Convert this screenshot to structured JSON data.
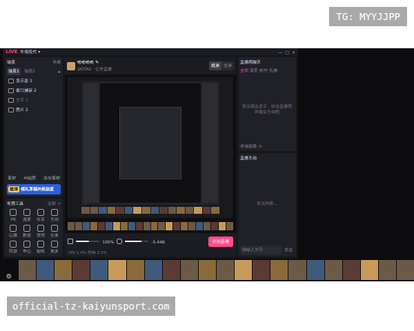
{
  "watermarks": {
    "top": "TG: MYYJJPP",
    "bottom": "official-tz-kaiyunsport.com"
  },
  "app": {
    "logo": "LIVE",
    "mode": "常规模式 ▾",
    "window_controls": [
      "—",
      "□",
      "×"
    ]
  },
  "scenes": {
    "title": "场景",
    "tool": "导播",
    "add": "+",
    "tabs": [
      {
        "label": "场景1",
        "selected": true
      },
      {
        "label": "场景2",
        "selected": false
      }
    ],
    "sources": [
      {
        "label": "显示器 1",
        "visible": true
      },
      {
        "label": "窗口捕获 2",
        "visible": true
      },
      {
        "label": "文字 1",
        "visible": false
      },
      {
        "label": "图片 2",
        "visible": true
      }
    ]
  },
  "asset_buttons": [
    "素材",
    "AI贴图",
    "添加素材"
  ],
  "banner": {
    "badge": "超清",
    "text": "领礼享额外奖励度"
  },
  "tools": {
    "title": "常用工具",
    "more": "全部 >",
    "items": [
      "PK",
      "连麦",
      "分享",
      "互动",
      "心愿",
      "数据",
      "管理",
      "任务",
      "回放",
      "中心",
      "贴纸",
      "更多"
    ]
  },
  "stream": {
    "title": "哈哈哈哈",
    "category": "DOTA2",
    "visibility": "公开直播",
    "orientation": [
      {
        "label": "横屏",
        "selected": true
      },
      {
        "label": "竖屏",
        "selected": false
      }
    ]
  },
  "controls": {
    "volume": {
      "reading": "100%",
      "level": 0.55
    },
    "mic": {
      "reading": "-5.44B",
      "level": 0.7
    },
    "start": "开始直播",
    "status": "CPU 1.0%  内存 2.1%"
  },
  "chat": {
    "title": "直播间聊天",
    "tabs": [
      {
        "label": "全部",
        "selected": true
      },
      {
        "label": "贵宾",
        "selected": false
      },
      {
        "label": "粉丝",
        "selected": false
      },
      {
        "label": "礼物",
        "selected": false
      }
    ],
    "empty": "暂无观众发言，快去直播间和观众互动吧",
    "viewers": "本场观看: 0"
  },
  "interaction": {
    "title": "直播互动",
    "empty": "暂无内容...",
    "input_placeholder": "聊输入文字",
    "send": "发送"
  }
}
